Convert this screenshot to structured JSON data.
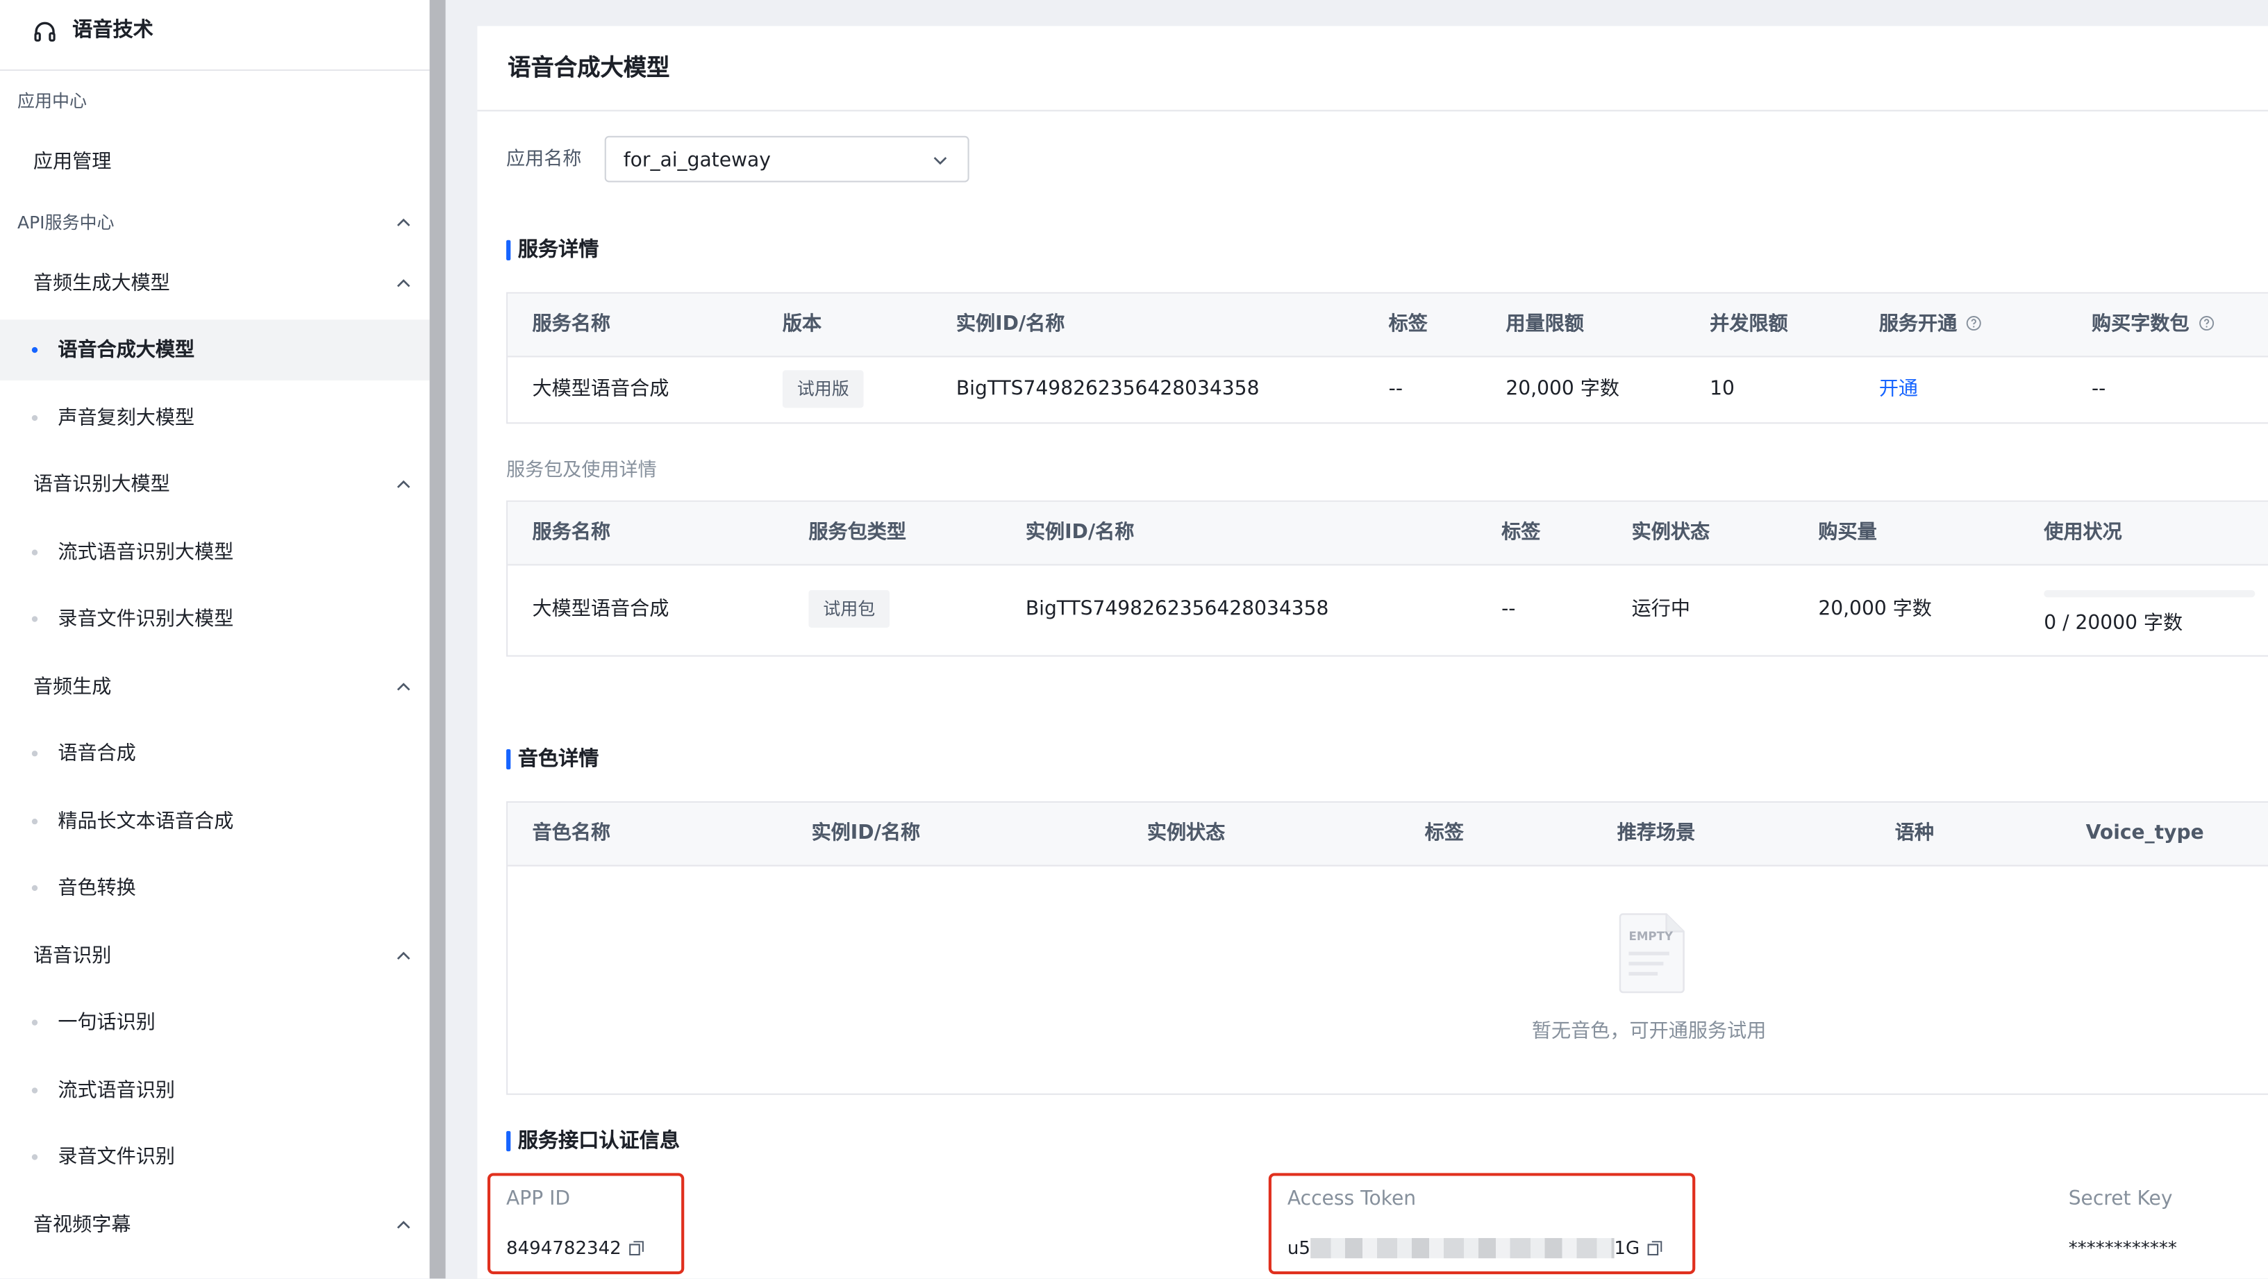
{
  "sidebar": {
    "title": "语音技术",
    "group_app_center": "应用中心",
    "app_management": "应用管理",
    "group_api_center": "API服务中心",
    "sections": [
      {
        "label": "音频生成大模型",
        "items": [
          "语音合成大模型",
          "声音复刻大模型"
        ]
      },
      {
        "label": "语音识别大模型",
        "items": [
          "流式语音识别大模型",
          "录音文件识别大模型"
        ]
      },
      {
        "label": "音频生成",
        "items": [
          "语音合成",
          "精品长文本语音合成",
          "音色转换"
        ]
      },
      {
        "label": "语音识别",
        "items": [
          "一句话识别",
          "流式语音识别",
          "录音文件识别"
        ]
      },
      {
        "label": "音视频字幕",
        "items": []
      }
    ],
    "active_item": "语音合成大模型"
  },
  "main": {
    "page_title": "语音合成大模型",
    "app_name_label": "应用名称",
    "app_name_value": "for_ai_gateway",
    "service_detail": {
      "title": "服务详情",
      "headers": [
        "服务名称",
        "版本",
        "实例ID/名称",
        "标签",
        "用量限额",
        "并发限额",
        "服务开通",
        "购买字数包"
      ],
      "row": {
        "service_name": "大模型语音合成",
        "version": "试用版",
        "instance_id": "BigTTS7498262356428034358",
        "tags": "--",
        "usage_limit": "20,000 字数",
        "concurrency": "10",
        "activate": "开通",
        "purchase": "--"
      }
    },
    "package_detail": {
      "title": "服务包及使用详情",
      "headers": [
        "服务名称",
        "服务包类型",
        "实例ID/名称",
        "标签",
        "实例状态",
        "购买量",
        "使用状况"
      ],
      "row": {
        "service_name": "大模型语音合成",
        "package_type": "试用包",
        "instance_id": "BigTTS7498262356428034358",
        "tags": "--",
        "status": "运行中",
        "purchase_amount": "20,000 字数",
        "usage": "0 / 20000 字数",
        "usage_fraction": 0
      }
    },
    "voice_detail": {
      "title": "音色详情",
      "headers": [
        "音色名称",
        "实例ID/名称",
        "实例状态",
        "标签",
        "推荐场景",
        "语种",
        "Voice_type"
      ],
      "empty_text": "暂无音色，可开通服务试用",
      "empty_icon_text": "EMPTY"
    },
    "auth_info": {
      "title": "服务接口认证信息",
      "app_id_label": "APP ID",
      "app_id_value": "8494782342",
      "access_token_label": "Access Token",
      "access_token_prefix": "u5",
      "access_token_suffix": "1G",
      "secret_key_label": "Secret Key",
      "secret_key_value": "************"
    }
  },
  "colors": {
    "accent": "#1664ff",
    "highlight_border": "#e0301e",
    "sidebar_scrollbar": "#b6b8bd"
  },
  "icons": [
    "headset-icon",
    "chevron-up-icon",
    "chevron-down-icon",
    "question-circle-icon",
    "empty-document-icon",
    "copy-icon"
  ]
}
